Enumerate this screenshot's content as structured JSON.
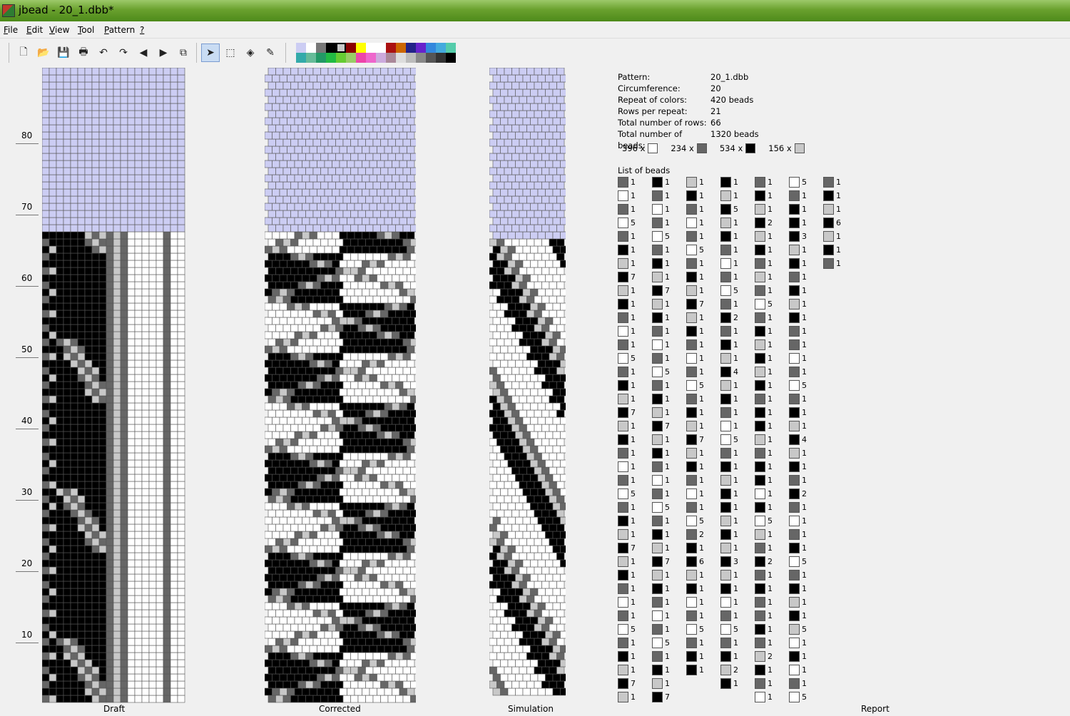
{
  "window": {
    "title": "jbead - 20_1.dbb*"
  },
  "menu": [
    {
      "label": "File",
      "u": "F",
      "rest": "ile"
    },
    {
      "label": "Edit",
      "u": "E",
      "rest": "dit"
    },
    {
      "label": "View",
      "u": "V",
      "rest": "iew"
    },
    {
      "label": "Tool",
      "u": "T",
      "rest": "ool"
    },
    {
      "label": "Pattern",
      "u": "P",
      "rest": "attern"
    },
    {
      "label": "?",
      "u": "?",
      "rest": ""
    }
  ],
  "toolbar": {
    "buttons": [
      {
        "name": "new-icon",
        "glyph": "🗋"
      },
      {
        "name": "open-icon",
        "glyph": "📂"
      },
      {
        "name": "save-icon",
        "glyph": "💾"
      },
      {
        "name": "print-icon",
        "glyph": "🖶"
      },
      {
        "name": "undo-icon",
        "glyph": "↶"
      },
      {
        "name": "redo-icon",
        "glyph": "↷"
      },
      {
        "name": "scroll-left-icon",
        "glyph": "◀"
      },
      {
        "name": "scroll-right-icon",
        "glyph": "▶"
      },
      {
        "name": "copy-icon",
        "glyph": "⧉"
      },
      {
        "name": "pencil-pointer-icon",
        "glyph": "➤"
      },
      {
        "name": "select-icon",
        "glyph": "⬚"
      },
      {
        "name": "fill-icon",
        "glyph": "◈"
      },
      {
        "name": "pipette-icon",
        "glyph": "✎"
      }
    ]
  },
  "palette": [
    "#cccdf3",
    "#ffffff",
    "#777777",
    "#000000",
    "#c8c8c8",
    "#8b0000",
    "#ffff00",
    "#ffffff",
    "#ffffff",
    "#aa1111",
    "#cc6600",
    "#222288",
    "#6622cc",
    "#3388dd",
    "#44aadd",
    "#55ccaa",
    "#33aaaa",
    "#66bb99",
    "#229966",
    "#22bb44",
    "#66cc33",
    "#99cc66",
    "#ee44aa",
    "#ee66cc",
    "#ccaadd",
    "#aa8899",
    "#dddddd",
    "#bbbbbb",
    "#888888",
    "#555555",
    "#333333",
    "#000000"
  ],
  "palette_selected": 4,
  "colors": {
    "bg": "#cccdf3",
    "white": "#ffffff",
    "gray": "#666666",
    "black": "#000000",
    "light": "#c8c8c8"
  },
  "ruler": [
    "80",
    "70",
    "60",
    "50",
    "40",
    "30",
    "20",
    "10"
  ],
  "captions": {
    "draft": "Draft",
    "corrected": "Corrected",
    "simulation": "Simulation",
    "report": "Report"
  },
  "report": {
    "rows": [
      {
        "key": "Pattern:",
        "value": "20_1.dbb"
      },
      {
        "key": "Circumference:",
        "value": "20"
      },
      {
        "key": "Repeat of colors:",
        "value": "420 beads"
      },
      {
        "key": "Rows per repeat:",
        "value": "21"
      },
      {
        "key": "Total number of rows:",
        "value": "66"
      },
      {
        "key": "Total number of beads:",
        "value": "1320 beads"
      }
    ],
    "counts": [
      {
        "count": "396 x",
        "color": "w"
      },
      {
        "count": "234 x",
        "color": "g"
      },
      {
        "count": "534 x",
        "color": "b"
      },
      {
        "count": "156 x",
        "color": "l"
      }
    ],
    "list_title": "List of beads",
    "bead_columns": [
      [
        [
          "g",
          "1"
        ],
        [
          "w",
          "1"
        ],
        [
          "g",
          "1"
        ],
        [
          "w",
          "5"
        ],
        [
          "g",
          "1"
        ],
        [
          "b",
          "1"
        ],
        [
          "l",
          "1"
        ],
        [
          "b",
          "7"
        ],
        [
          "l",
          "1"
        ],
        [
          "b",
          "1"
        ],
        [
          "g",
          "1"
        ],
        [
          "w",
          "1"
        ],
        [
          "g",
          "1"
        ],
        [
          "w",
          "5"
        ],
        [
          "g",
          "1"
        ],
        [
          "b",
          "1"
        ],
        [
          "l",
          "1"
        ],
        [
          "b",
          "7"
        ],
        [
          "l",
          "1"
        ],
        [
          "b",
          "1"
        ],
        [
          "g",
          "1"
        ],
        [
          "w",
          "1"
        ],
        [
          "g",
          "1"
        ],
        [
          "w",
          "5"
        ],
        [
          "g",
          "1"
        ],
        [
          "b",
          "1"
        ],
        [
          "l",
          "1"
        ],
        [
          "b",
          "7"
        ],
        [
          "l",
          "1"
        ],
        [
          "b",
          "1"
        ],
        [
          "g",
          "1"
        ],
        [
          "w",
          "1"
        ],
        [
          "g",
          "1"
        ],
        [
          "w",
          "5"
        ],
        [
          "g",
          "1"
        ],
        [
          "b",
          "1"
        ],
        [
          "l",
          "1"
        ],
        [
          "b",
          "7"
        ],
        [
          "l",
          "1"
        ]
      ],
      [
        [
          "b",
          "1"
        ],
        [
          "g",
          "1"
        ],
        [
          "w",
          "1"
        ],
        [
          "g",
          "1"
        ],
        [
          "w",
          "5"
        ],
        [
          "g",
          "1"
        ],
        [
          "b",
          "1"
        ],
        [
          "l",
          "1"
        ],
        [
          "b",
          "7"
        ],
        [
          "l",
          "1"
        ],
        [
          "b",
          "1"
        ],
        [
          "g",
          "1"
        ],
        [
          "w",
          "1"
        ],
        [
          "g",
          "1"
        ],
        [
          "w",
          "5"
        ],
        [
          "g",
          "1"
        ],
        [
          "b",
          "1"
        ],
        [
          "l",
          "1"
        ],
        [
          "b",
          "7"
        ],
        [
          "l",
          "1"
        ],
        [
          "b",
          "1"
        ],
        [
          "g",
          "1"
        ],
        [
          "w",
          "1"
        ],
        [
          "g",
          "1"
        ],
        [
          "w",
          "5"
        ],
        [
          "g",
          "1"
        ],
        [
          "b",
          "1"
        ],
        [
          "l",
          "1"
        ],
        [
          "b",
          "7"
        ],
        [
          "l",
          "1"
        ],
        [
          "b",
          "1"
        ],
        [
          "g",
          "1"
        ],
        [
          "w",
          "1"
        ],
        [
          "g",
          "1"
        ],
        [
          "w",
          "5"
        ],
        [
          "g",
          "1"
        ],
        [
          "b",
          "1"
        ],
        [
          "l",
          "1"
        ],
        [
          "b",
          "7"
        ]
      ],
      [
        [
          "l",
          "1"
        ],
        [
          "b",
          "1"
        ],
        [
          "g",
          "1"
        ],
        [
          "w",
          "1"
        ],
        [
          "g",
          "1"
        ],
        [
          "w",
          "5"
        ],
        [
          "g",
          "1"
        ],
        [
          "b",
          "1"
        ],
        [
          "l",
          "1"
        ],
        [
          "b",
          "7"
        ],
        [
          "l",
          "1"
        ],
        [
          "b",
          "1"
        ],
        [
          "g",
          "1"
        ],
        [
          "w",
          "1"
        ],
        [
          "g",
          "1"
        ],
        [
          "w",
          "5"
        ],
        [
          "g",
          "1"
        ],
        [
          "b",
          "1"
        ],
        [
          "l",
          "1"
        ],
        [
          "b",
          "7"
        ],
        [
          "l",
          "1"
        ],
        [
          "b",
          "1"
        ],
        [
          "g",
          "1"
        ],
        [
          "w",
          "1"
        ],
        [
          "g",
          "1"
        ],
        [
          "w",
          "5"
        ],
        [
          "g",
          "2"
        ],
        [
          "b",
          "1"
        ],
        [
          "b",
          "6"
        ],
        [
          "l",
          "1"
        ],
        [
          "b",
          "1"
        ],
        [
          "w",
          "1"
        ],
        [
          "g",
          "1"
        ],
        [
          "w",
          "5"
        ],
        [
          "g",
          "1"
        ],
        [
          "b",
          "1"
        ],
        [
          "b",
          "1"
        ]
      ],
      [
        [
          "b",
          "1"
        ],
        [
          "l",
          "1"
        ],
        [
          "b",
          "5"
        ],
        [
          "l",
          "1"
        ],
        [
          "b",
          "1"
        ],
        [
          "g",
          "1"
        ],
        [
          "w",
          "1"
        ],
        [
          "g",
          "1"
        ],
        [
          "w",
          "5"
        ],
        [
          "g",
          "1"
        ],
        [
          "b",
          "2"
        ],
        [
          "g",
          "1"
        ],
        [
          "b",
          "1"
        ],
        [
          "l",
          "1"
        ],
        [
          "b",
          "4"
        ],
        [
          "l",
          "1"
        ],
        [
          "b",
          "1"
        ],
        [
          "g",
          "1"
        ],
        [
          "w",
          "1"
        ],
        [
          "w",
          "5"
        ],
        [
          "g",
          "1"
        ],
        [
          "b",
          "1"
        ],
        [
          "l",
          "1"
        ],
        [
          "b",
          "1"
        ],
        [
          "b",
          "1"
        ],
        [
          "l",
          "1"
        ],
        [
          "b",
          "1"
        ],
        [
          "l",
          "1"
        ],
        [
          "b",
          "3"
        ],
        [
          "l",
          "1"
        ],
        [
          "b",
          "1"
        ],
        [
          "w",
          "1"
        ],
        [
          "g",
          "1"
        ],
        [
          "w",
          "5"
        ],
        [
          "g",
          "1"
        ],
        [
          "b",
          "1"
        ],
        [
          "l",
          "2"
        ],
        [
          "b",
          "1"
        ]
      ],
      [
        [
          "g",
          "1"
        ],
        [
          "b",
          "1"
        ],
        [
          "l",
          "1"
        ],
        [
          "b",
          "2"
        ],
        [
          "l",
          "1"
        ],
        [
          "b",
          "1"
        ],
        [
          "g",
          "1"
        ],
        [
          "l",
          "1"
        ],
        [
          "g",
          "1"
        ],
        [
          "w",
          "5"
        ],
        [
          "g",
          "1"
        ],
        [
          "b",
          "1"
        ],
        [
          "l",
          "1"
        ],
        [
          "b",
          "1"
        ],
        [
          "l",
          "1"
        ],
        [
          "b",
          "1"
        ],
        [
          "g",
          "1"
        ],
        [
          "b",
          "1"
        ],
        [
          "b",
          "1"
        ],
        [
          "l",
          "1"
        ],
        [
          "g",
          "1"
        ],
        [
          "b",
          "1"
        ],
        [
          "b",
          "1"
        ],
        [
          "w",
          "1"
        ],
        [
          "b",
          "1"
        ],
        [
          "w",
          "5"
        ],
        [
          "l",
          "1"
        ],
        [
          "g",
          "1"
        ],
        [
          "b",
          "2"
        ],
        [
          "g",
          "1"
        ],
        [
          "b",
          "1"
        ],
        [
          "g",
          "1"
        ],
        [
          "g",
          "1"
        ],
        [
          "b",
          "1"
        ],
        [
          "g",
          "1"
        ],
        [
          "l",
          "2"
        ],
        [
          "b",
          "1"
        ],
        [
          "g",
          "1"
        ],
        [
          "w",
          "1"
        ],
        [
          "l",
          "1"
        ]
      ],
      [
        [
          "w",
          "5"
        ],
        [
          "g",
          "1"
        ],
        [
          "b",
          "1"
        ],
        [
          "b",
          "1"
        ],
        [
          "b",
          "3"
        ],
        [
          "l",
          "1"
        ],
        [
          "b",
          "1"
        ],
        [
          "g",
          "1"
        ],
        [
          "b",
          "1"
        ],
        [
          "l",
          "1"
        ],
        [
          "b",
          "1"
        ],
        [
          "g",
          "1"
        ],
        [
          "g",
          "1"
        ],
        [
          "w",
          "1"
        ],
        [
          "g",
          "1"
        ],
        [
          "w",
          "5"
        ],
        [
          "g",
          "1"
        ],
        [
          "b",
          "1"
        ],
        [
          "l",
          "1"
        ],
        [
          "b",
          "4"
        ],
        [
          "l",
          "1"
        ],
        [
          "b",
          "1"
        ],
        [
          "g",
          "1"
        ],
        [
          "b",
          "2"
        ],
        [
          "g",
          "1"
        ],
        [
          "w",
          "1"
        ],
        [
          "g",
          "1"
        ],
        [
          "b",
          "1"
        ],
        [
          "w",
          "5"
        ],
        [
          "g",
          "1"
        ],
        [
          "b",
          "1"
        ],
        [
          "l",
          "1"
        ],
        [
          "b",
          "1"
        ],
        [
          "l",
          "5"
        ],
        [
          "w",
          "1"
        ],
        [
          "b",
          "1"
        ],
        [
          "w",
          "1"
        ],
        [
          "g",
          "1"
        ],
        [
          "w",
          "5"
        ]
      ],
      [
        [
          "g",
          "1"
        ],
        [
          "b",
          "1"
        ],
        [
          "l",
          "1"
        ],
        [
          "b",
          "6"
        ],
        [
          "l",
          "1"
        ],
        [
          "b",
          "1"
        ],
        [
          "g",
          "1"
        ]
      ]
    ]
  }
}
